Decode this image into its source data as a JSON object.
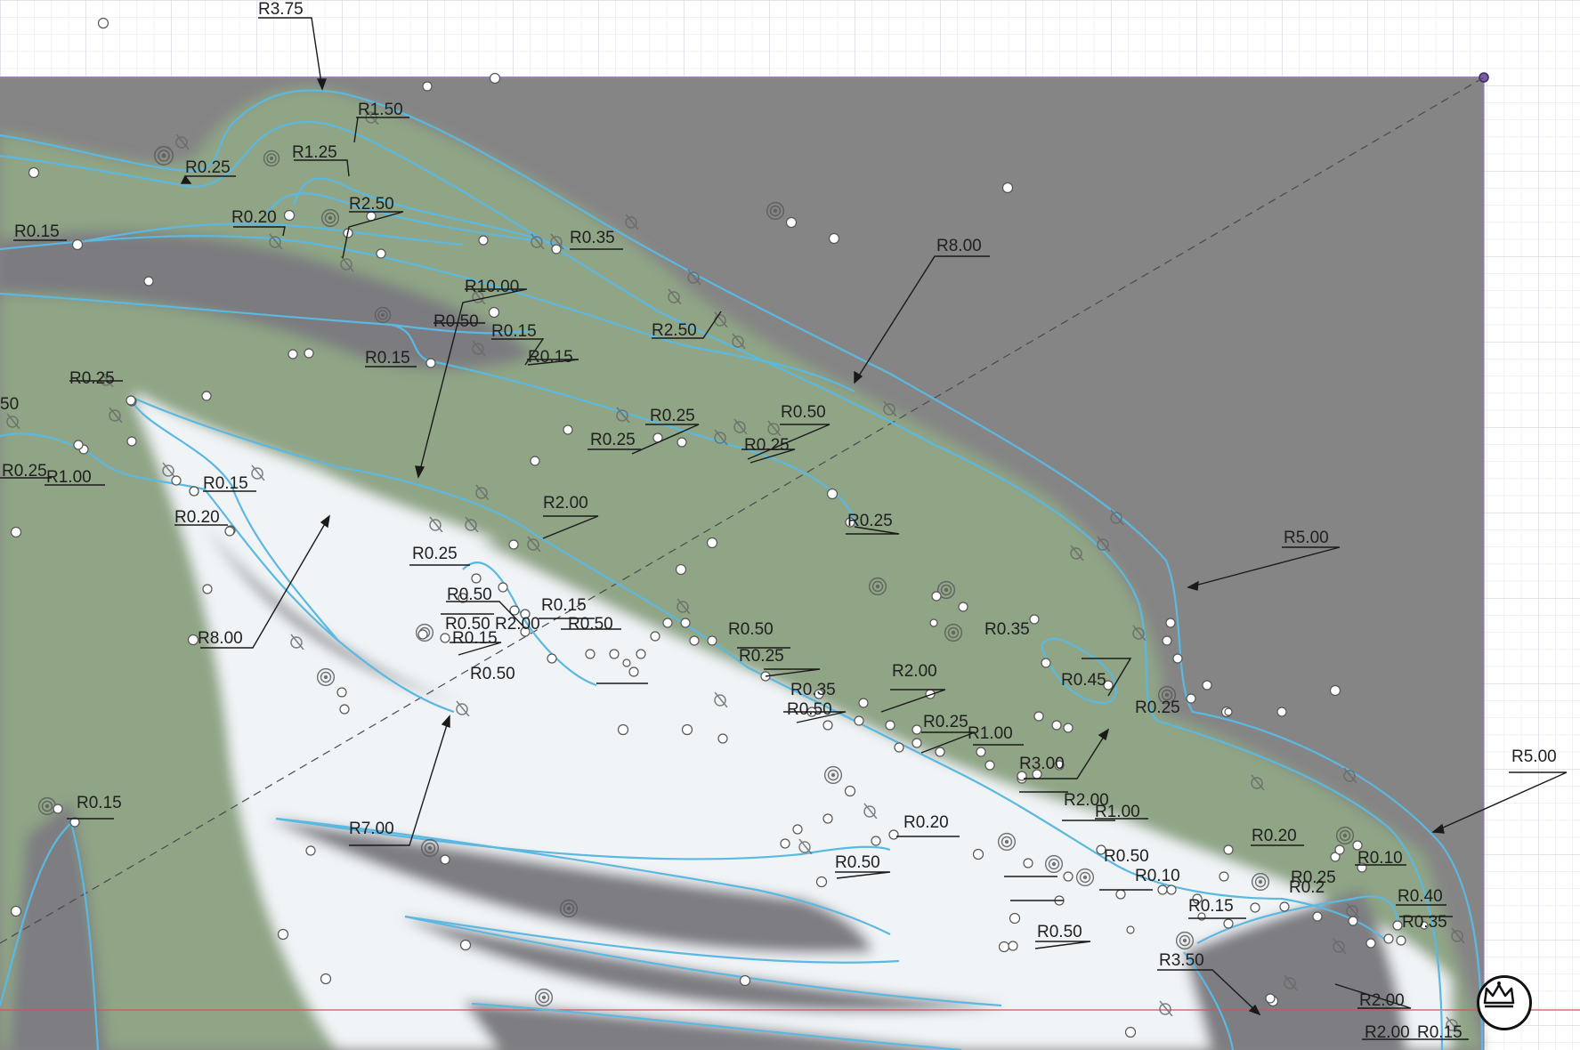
{
  "workspace": {
    "title": "sketch-canvas",
    "colors": {
      "background": "#ffffff",
      "grid_minor": "#e9edf2",
      "grid_major": "#d7dde6",
      "canvas_gray": "#838383",
      "shape_green": "#8fa585",
      "shape_white": "#f3f6f9",
      "curve": "#5bb8e0",
      "dim_line": "#1a1a1a",
      "x_axis": "#d8534f",
      "frame_line": "#9c7cc2"
    }
  },
  "dimensions": [
    {
      "id": "d1",
      "text": "R3.75"
    },
    {
      "id": "d2",
      "text": "R1.50"
    },
    {
      "id": "d3",
      "text": "R1.25"
    },
    {
      "id": "d4",
      "text": "R0.25"
    },
    {
      "id": "d5",
      "text": "R2.50"
    },
    {
      "id": "d6",
      "text": "R0.20"
    },
    {
      "id": "d7",
      "text": "R0.15"
    },
    {
      "id": "d8",
      "text": "R0.35"
    },
    {
      "id": "d9",
      "text": "R8.00"
    },
    {
      "id": "d10",
      "text": "R10.00"
    },
    {
      "id": "d11",
      "text": "R2.50"
    },
    {
      "id": "d12",
      "text": "R0.50"
    },
    {
      "id": "d13",
      "text": "R0.15"
    },
    {
      "id": "d14",
      "text": "R0.15"
    },
    {
      "id": "d15",
      "text": "R0.15"
    },
    {
      "id": "d16",
      "text": "R0.25"
    },
    {
      "id": "d17",
      "text": "50"
    },
    {
      "id": "d18",
      "text": "R0.25"
    },
    {
      "id": "d19",
      "text": "R1.00"
    },
    {
      "id": "d20",
      "text": "R0.15"
    },
    {
      "id": "d21",
      "text": "R0.20"
    },
    {
      "id": "d22",
      "text": "R0.25"
    },
    {
      "id": "d23",
      "text": "R0.50"
    },
    {
      "id": "d24",
      "text": "R0.25"
    },
    {
      "id": "d25",
      "text": "R0.25"
    },
    {
      "id": "d26",
      "text": "R0.25"
    },
    {
      "id": "d27",
      "text": "R2.00"
    },
    {
      "id": "d28",
      "text": "R5.00"
    },
    {
      "id": "d29",
      "text": "R0.25"
    },
    {
      "id": "d30",
      "text": "R8.00"
    },
    {
      "id": "d31",
      "text": "R0.50"
    },
    {
      "id": "d32",
      "text": "R0.15"
    },
    {
      "id": "d33",
      "text": "R0.50"
    },
    {
      "id": "d34",
      "text": "R2.00"
    },
    {
      "id": "d35",
      "text": "R0.50"
    },
    {
      "id": "d36",
      "text": "R0.15"
    },
    {
      "id": "d37",
      "text": "R0.50"
    },
    {
      "id": "d38",
      "text": "R0.50"
    },
    {
      "id": "d39",
      "text": "R0.25"
    },
    {
      "id": "d40",
      "text": "R0.35"
    },
    {
      "id": "d41",
      "text": "R0.50"
    },
    {
      "id": "d42",
      "text": "R0.35"
    },
    {
      "id": "d43",
      "text": "R0.45"
    },
    {
      "id": "d44",
      "text": "R2.00"
    },
    {
      "id": "d45",
      "text": "R0.25"
    },
    {
      "id": "d46",
      "text": "R1.00"
    },
    {
      "id": "d47",
      "text": "R3.00"
    },
    {
      "id": "d48",
      "text": "R0.25"
    },
    {
      "id": "d49",
      "text": "R2.00"
    },
    {
      "id": "d50",
      "text": "R1.00"
    },
    {
      "id": "d51",
      "text": "R0.15"
    },
    {
      "id": "d52",
      "text": "R7.00"
    },
    {
      "id": "d53",
      "text": "R0.20"
    },
    {
      "id": "d54",
      "text": "R0.50"
    },
    {
      "id": "d55",
      "text": "R0.50"
    },
    {
      "id": "d56",
      "text": "R0.10"
    },
    {
      "id": "d57",
      "text": "R0.15"
    },
    {
      "id": "d58",
      "text": "R0.50"
    },
    {
      "id": "d59",
      "text": "R3.50"
    },
    {
      "id": "d60",
      "text": "R0.20"
    },
    {
      "id": "d61",
      "text": "R0.10"
    },
    {
      "id": "d62",
      "text": "R0.40"
    },
    {
      "id": "d63",
      "text": "R0.35"
    },
    {
      "id": "d64",
      "text": "R5.00"
    },
    {
      "id": "d65",
      "text": "R2.00"
    },
    {
      "id": "d66",
      "text": "R2.00"
    },
    {
      "id": "d67",
      "text": "R0.15"
    },
    {
      "id": "d68",
      "text": "R0.25"
    },
    {
      "id": "d69",
      "text": "R0.2"
    }
  ],
  "logo": {
    "icon": "crown-logo-icon"
  }
}
